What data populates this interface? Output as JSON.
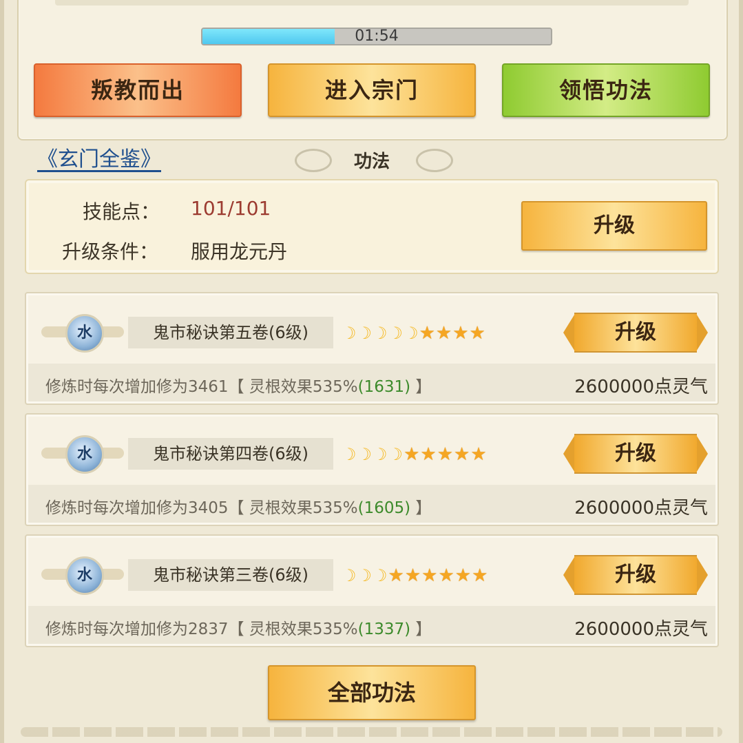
{
  "timer": {
    "text": "01:54",
    "progress_fraction": 0.38
  },
  "actions": {
    "leave_label": "叛教而出",
    "enter_label": "进入宗门",
    "comprehend_label": "领悟功法"
  },
  "link": {
    "encyclopedia": "《玄门全鉴》"
  },
  "section": {
    "title": "功法"
  },
  "skill_points": {
    "label": "技能点：",
    "value": "101/101",
    "condition_label": "升级条件：",
    "condition_value": "服用龙元丹",
    "upgrade_label": "升级"
  },
  "skills": [
    {
      "element": "水",
      "name": "鬼市秘诀第五卷(6级)",
      "moons": 5,
      "stars": 4,
      "upgrade_label": "升级",
      "desc_prefix": "修炼时每次增加修为3461【 灵根效果535%",
      "desc_bonus": "(1631)",
      "desc_suffix": " 】",
      "cost": "2600000点灵气"
    },
    {
      "element": "水",
      "name": "鬼市秘诀第四卷(6级)",
      "moons": 4,
      "stars": 5,
      "upgrade_label": "升级",
      "desc_prefix": "修炼时每次增加修为3405【 灵根效果535%",
      "desc_bonus": "(1605)",
      "desc_suffix": " 】",
      "cost": "2600000点灵气"
    },
    {
      "element": "水",
      "name": "鬼市秘诀第三卷(6级)",
      "moons": 3,
      "stars": 6,
      "upgrade_label": "升级",
      "desc_prefix": "修炼时每次增加修为2837【 灵根效果535%",
      "desc_bonus": "(1337)",
      "desc_suffix": " 】",
      "cost": "2600000点灵气"
    }
  ],
  "footer": {
    "all_skills_label": "全部功法"
  },
  "colors": {
    "points_value": "#9c3b30",
    "bonus_green": "#3c8a2b",
    "progress_fill": "#4fc8ef"
  }
}
